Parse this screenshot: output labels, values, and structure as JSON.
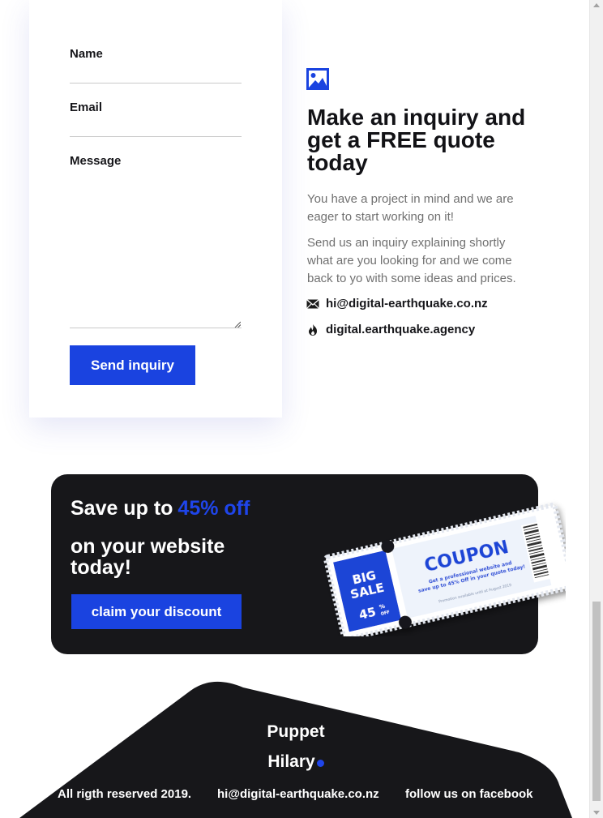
{
  "form": {
    "name_label": "Name",
    "email_label": "Email",
    "message_label": "Message",
    "submit_label": "Send inquiry"
  },
  "info": {
    "icon": "image-icon",
    "title": "Make an inquiry and get a FREE quote today",
    "paragraph_1": "You have a project in mind and we are eager to start working on it!",
    "paragraph_2": "Send us an inquiry explaining shortly what are you looking for and we come back to yo with some ideas and prices.",
    "email": "hi@digital-earthquake.co.nz",
    "website": "digital.earthquake.agency"
  },
  "promo": {
    "headline_prefix": "Save up to",
    "headline_accent": "45% off",
    "headline_rest": "on your website today!",
    "button_label": "claim your discount",
    "coupon": {
      "badge_line1": "BIG",
      "badge_line2": "SALE",
      "badge_percent": "45",
      "badge_percent_sign": "%",
      "badge_off": "OFF",
      "title": "COUPON",
      "subtitle_line1": "Get a professional website and",
      "subtitle_line2": "save up to 45% Off in your quote today!",
      "fine_print": "Promotion available until at August 2019"
    }
  },
  "footer": {
    "brand_line1": "Puppet",
    "brand_line2": "Hilary",
    "copyright": "All rigth reserved 2019.",
    "email": "hi@digital-earthquake.co.nz",
    "social": "follow us on facebook"
  },
  "colors": {
    "accent": "#1a43e0",
    "dark": "#17171a",
    "muted_text": "#707070"
  }
}
